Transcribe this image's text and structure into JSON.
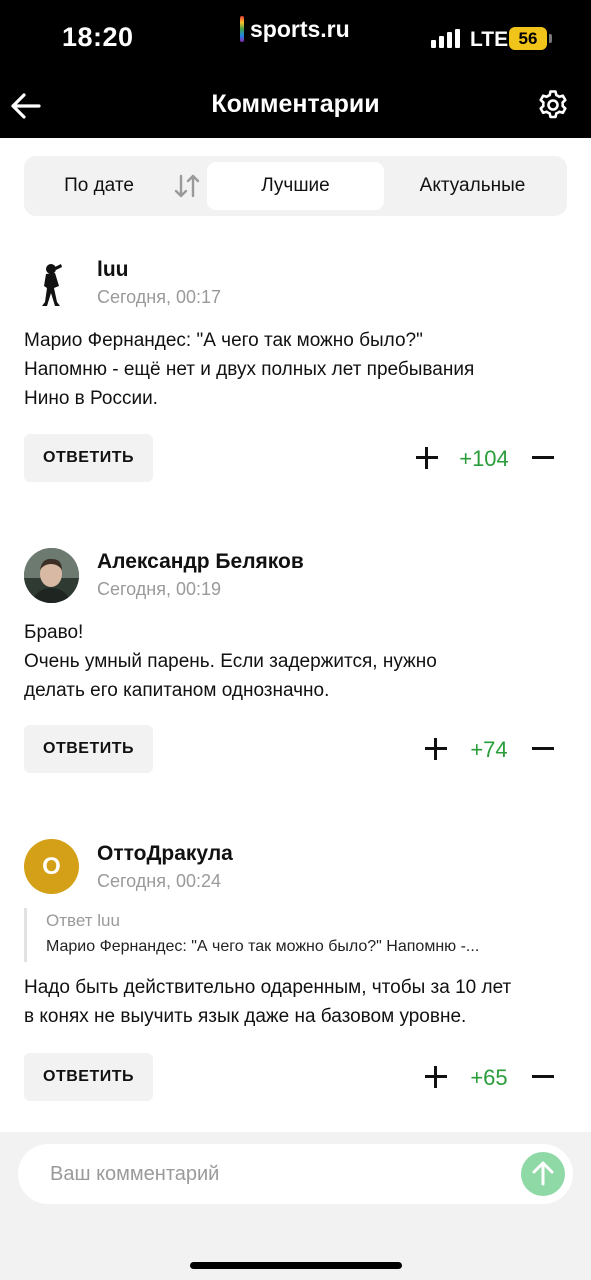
{
  "status_bar": {
    "time": "18:20",
    "brand": "sports.ru",
    "network": "LTE",
    "battery": "56"
  },
  "header": {
    "title": "Комментарии",
    "back_icon": "arrow-left-icon",
    "settings_icon": "gear-icon"
  },
  "tabs": {
    "items": [
      {
        "label": "По дате"
      },
      {
        "label": "Лучшие"
      },
      {
        "label": "Актуальные"
      }
    ],
    "active": "Лучшие",
    "sort_icon": "sort-arrows-icon"
  },
  "comments": [
    {
      "author": "luu",
      "time": "Сегодня, 00:17",
      "text": "Марио Фернандес: \"А чего так можно было?\"\nНапомню - ещё нет и двух полных лет пребывания\nНино в России.",
      "reply_label": "ОТВЕТИТЬ",
      "score": "+104"
    },
    {
      "author": "Александр Беляков",
      "time": "Сегодня, 00:19",
      "text": "Браво!\nОчень умный парень. Если задержится,  нужно\nделать его капитаном однозначно.",
      "reply_label": "ОТВЕТИТЬ",
      "score": "+74"
    },
    {
      "author": "ОттоДракула",
      "avatar_letter": "О",
      "time": "Сегодня, 00:24",
      "quote_prefix": "Ответ",
      "quote_author": "luu",
      "quote_text": "Марио Фернандес: \"А чего так можно было?\" Напомню -...",
      "text": "Надо быть действительно одаренным, чтобы за 10 лет\nв конях не выучить язык даже на базовом уровне.",
      "reply_label": "ОТВЕТИТЬ",
      "score": "+65"
    }
  ],
  "composer": {
    "placeholder": "Ваш комментарий",
    "send_icon": "arrow-up-icon"
  },
  "colors": {
    "score_positive": "#2a9d3b",
    "send_button": "#8fd9a6",
    "avatar_otto": "#d4a017"
  }
}
